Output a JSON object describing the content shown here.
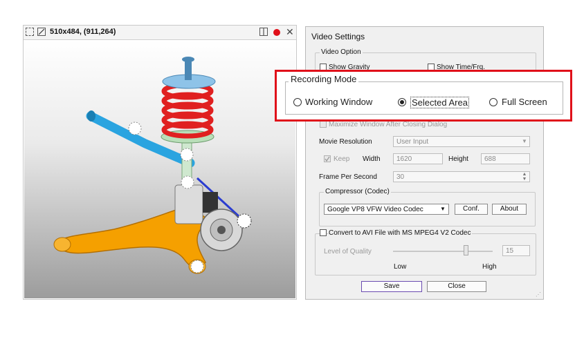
{
  "capture_window": {
    "title": "510x484, (911,264)",
    "icons": [
      "crop-icon",
      "resize-icon",
      "layout-icon",
      "record-dot-icon",
      "close-icon"
    ]
  },
  "dialog": {
    "title": "Video Settings",
    "video_option": {
      "caption": "Video Option",
      "show_gravity": "Show Gravity",
      "show_time": "Show Time/Frq."
    },
    "maximize_label": "Maximize Window After Closing Dialog",
    "movie_resolution": {
      "label": "Movie Resolution",
      "value": "User Input"
    },
    "keep_label": "Keep",
    "width": {
      "label": "Width",
      "value": "1620"
    },
    "height": {
      "label": "Height",
      "value": "688"
    },
    "fps": {
      "label": "Frame Per Second",
      "value": "30"
    },
    "compressor": {
      "caption": "Compressor (Codec)",
      "value": "Google VP8 VFW Video Codec",
      "conf_button": "Conf.",
      "about_button": "About"
    },
    "convert": {
      "label": "Convert to AVI File with MS MPEG4 V2 Codec",
      "quality_label": "Level of Quality",
      "quality_value": "15",
      "low": "Low",
      "high": "High"
    },
    "save_button": "Save",
    "close_button": "Close"
  },
  "recording_mode": {
    "caption": "Recording Mode",
    "options": [
      "Working Window",
      "Selected Area",
      "Full Screen"
    ],
    "selected": "Selected Area"
  },
  "colors": {
    "highlight": "#e0101a",
    "spring": "#e02020",
    "arm": "#f5a000",
    "bar": "#2aa4e0",
    "cap": "#8ec3e8"
  }
}
